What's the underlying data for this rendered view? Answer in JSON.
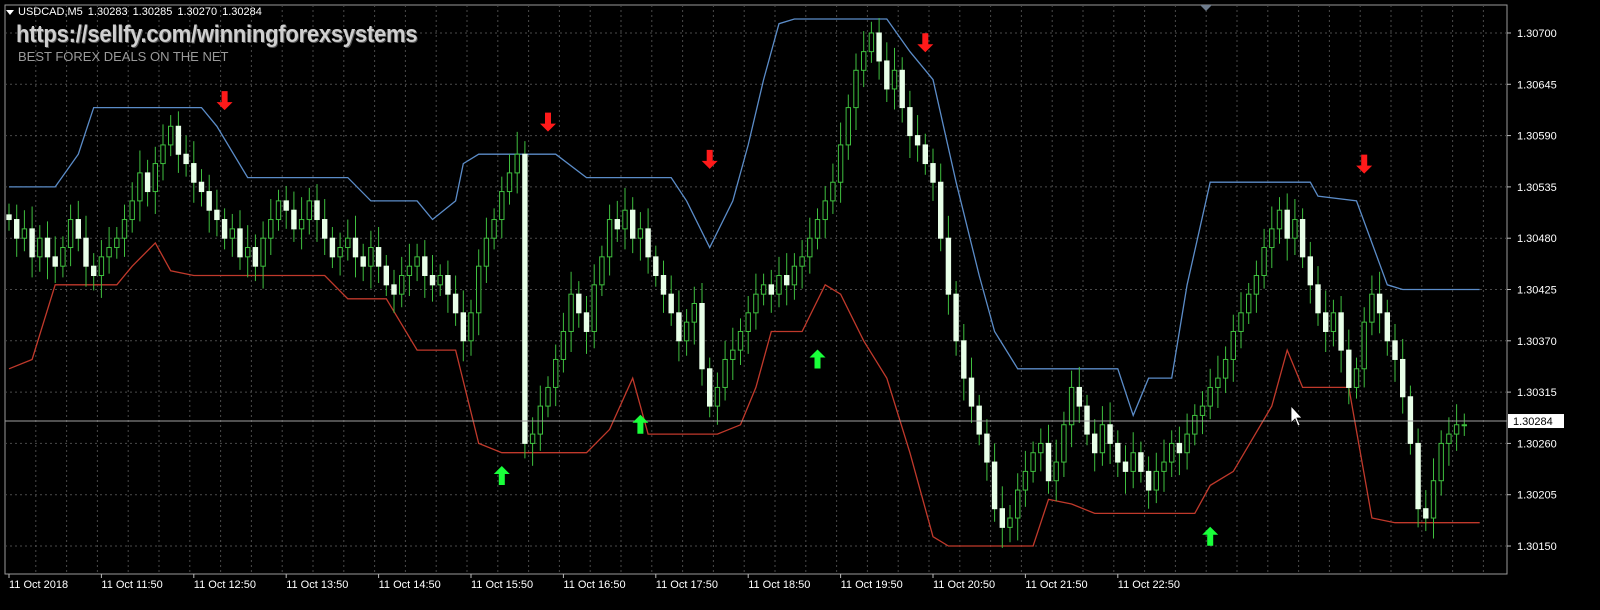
{
  "window": {
    "symbol": "USDCAD,M5",
    "ohlc": [
      "1.30283",
      "1.30285",
      "1.30270",
      "1.30284"
    ]
  },
  "watermark": {
    "url": "https://sellfy.com/winningforexsystems",
    "tagline": "BEST FOREX DEALS ON THE NET"
  },
  "colors": {
    "background": "#000000",
    "grid": "#4a4a4a",
    "bull_candle": "#3fbf3f",
    "bear_candle": "#e8ffe8",
    "upper_channel": "#5b8cc8",
    "lower_channel": "#c0392b",
    "sell_arrow": "#ff1a1a",
    "buy_arrow": "#19ff3a",
    "axis_text": "#ffffff",
    "price_line": "#a0a0a0"
  },
  "chart_data": {
    "type": "candlestick",
    "x_tick_labels": [
      "11 Oct 2018",
      "11 Oct 11:50",
      "11 Oct 12:50",
      "11 Oct 13:50",
      "11 Oct 14:50",
      "11 Oct 15:50",
      "11 Oct 16:50",
      "11 Oct 17:50",
      "11 Oct 18:50",
      "11 Oct 19:50",
      "11 Oct 20:50",
      "11 Oct 21:50",
      "11 Oct 22:50"
    ],
    "y_tick_labels": [
      "1.30700",
      "1.30645",
      "1.30590",
      "1.30535",
      "1.30480",
      "1.30425",
      "1.30370",
      "1.30315",
      "1.30260",
      "1.30205",
      "1.30150"
    ],
    "ylim": [
      1.3012,
      1.3073
    ],
    "bars_per_hour": 12,
    "current_price": 1.30284,
    "current_price_label": "1.30284",
    "close": [
      1.305,
      1.3048,
      1.3049,
      1.3046,
      1.3048,
      1.3046,
      1.3045,
      1.3047,
      1.305,
      1.3048,
      1.3045,
      1.3044,
      1.3046,
      1.3047,
      1.3048,
      1.305,
      1.3052,
      1.3055,
      1.3053,
      1.3056,
      1.3058,
      1.306,
      1.3057,
      1.3056,
      1.3054,
      1.3053,
      1.3051,
      1.305,
      1.3048,
      1.3049,
      1.3046,
      1.3047,
      1.3045,
      1.3048,
      1.305,
      1.3052,
      1.3051,
      1.3049,
      1.305,
      1.3052,
      1.305,
      1.3048,
      1.3046,
      1.3047,
      1.3048,
      1.3046,
      1.3045,
      1.3047,
      1.3045,
      1.3043,
      1.3042,
      1.3044,
      1.3045,
      1.3046,
      1.3044,
      1.3043,
      1.3044,
      1.3042,
      1.304,
      1.3037,
      1.304,
      1.3045,
      1.3048,
      1.305,
      1.3053,
      1.3055,
      1.3057,
      1.3026,
      1.3027,
      1.303,
      1.3032,
      1.3035,
      1.3038,
      1.3042,
      1.304,
      1.3038,
      1.3043,
      1.3046,
      1.305,
      1.3049,
      1.3051,
      1.3048,
      1.3049,
      1.3046,
      1.3044,
      1.3042,
      1.304,
      1.3037,
      1.3039,
      1.3041,
      1.3034,
      1.303,
      1.3032,
      1.3035,
      1.3036,
      1.3038,
      1.304,
      1.3042,
      1.3043,
      1.3042,
      1.3044,
      1.3043,
      1.3045,
      1.3046,
      1.3048,
      1.305,
      1.3052,
      1.3054,
      1.3058,
      1.3062,
      1.3066,
      1.3068,
      1.307,
      1.3067,
      1.3064,
      1.3066,
      1.3062,
      1.3059,
      1.3058,
      1.3056,
      1.3054,
      1.3048,
      1.3042,
      1.3037,
      1.3033,
      1.303,
      1.3027,
      1.3024,
      1.3019,
      1.3017,
      1.3018,
      1.3021,
      1.3023,
      1.3025,
      1.3026,
      1.3022,
      1.3024,
      1.3028,
      1.3032,
      1.303,
      1.3027,
      1.3025,
      1.3028,
      1.3026,
      1.3024,
      1.3023,
      1.3025,
      1.3023,
      1.3021,
      1.3023,
      1.3024,
      1.3026,
      1.3025,
      1.3027,
      1.3029,
      1.303,
      1.3032,
      1.3033,
      1.3035,
      1.3038,
      1.304,
      1.3042,
      1.3044,
      1.3047,
      1.3049,
      1.3051,
      1.3048,
      1.305,
      1.3046,
      1.3043,
      1.304,
      1.3038,
      1.304,
      1.3036,
      1.3032,
      1.3034,
      1.3039,
      1.3042,
      1.304,
      1.3037,
      1.3035,
      1.3031,
      1.3026,
      1.3019,
      1.3018,
      1.3022,
      1.3026,
      1.3027,
      1.3028,
      1.3028
    ],
    "upper_channel": [
      [
        0,
        1.30535
      ],
      [
        6,
        1.30535
      ],
      [
        9,
        1.3057
      ],
      [
        11,
        1.3062
      ],
      [
        25,
        1.3062
      ],
      [
        27,
        1.306
      ],
      [
        31,
        1.30545
      ],
      [
        44,
        1.30545
      ],
      [
        47,
        1.3052
      ],
      [
        53,
        1.3052
      ],
      [
        55,
        1.305
      ],
      [
        58,
        1.3052
      ],
      [
        59,
        1.3056
      ],
      [
        61,
        1.3057
      ],
      [
        71,
        1.3057
      ],
      [
        75,
        1.30545
      ],
      [
        86,
        1.30545
      ],
      [
        88,
        1.3052
      ],
      [
        91,
        1.3047
      ],
      [
        94,
        1.3052
      ],
      [
        96,
        1.3058
      ],
      [
        98,
        1.3065
      ],
      [
        100,
        1.3071
      ],
      [
        102,
        1.30715
      ],
      [
        114,
        1.30715
      ],
      [
        117,
        1.3068
      ],
      [
        120,
        1.3065
      ],
      [
        123,
        1.3054
      ],
      [
        126,
        1.3044
      ],
      [
        128,
        1.3038
      ],
      [
        131,
        1.3034
      ],
      [
        144,
        1.3034
      ],
      [
        146,
        1.3029
      ],
      [
        148,
        1.3033
      ],
      [
        151,
        1.3033
      ],
      [
        153,
        1.3043
      ],
      [
        156,
        1.3054
      ],
      [
        169,
        1.3054
      ],
      [
        170,
        1.30525
      ],
      [
        175,
        1.3052
      ],
      [
        179,
        1.3043
      ],
      [
        181,
        1.30425
      ],
      [
        191,
        1.30425
      ]
    ],
    "lower_channel": [
      [
        0,
        1.3034
      ],
      [
        3,
        1.3035
      ],
      [
        6,
        1.3043
      ],
      [
        10,
        1.3043
      ],
      [
        14,
        1.3043
      ],
      [
        16,
        1.3045
      ],
      [
        19,
        1.30475
      ],
      [
        21,
        1.30445
      ],
      [
        24,
        1.3044
      ],
      [
        28,
        1.3044
      ],
      [
        33,
        1.3044
      ],
      [
        41,
        1.3044
      ],
      [
        44,
        1.30415
      ],
      [
        49,
        1.30415
      ],
      [
        53,
        1.3036
      ],
      [
        58,
        1.3036
      ],
      [
        61,
        1.3026
      ],
      [
        64,
        1.3025
      ],
      [
        75,
        1.3025
      ],
      [
        78,
        1.30275
      ],
      [
        81,
        1.3033
      ],
      [
        83,
        1.3027
      ],
      [
        92,
        1.3027
      ],
      [
        95,
        1.3028
      ],
      [
        97,
        1.3032
      ],
      [
        99,
        1.3038
      ],
      [
        103,
        1.3038
      ],
      [
        106,
        1.3043
      ],
      [
        108,
        1.3042
      ],
      [
        111,
        1.3037
      ],
      [
        114,
        1.3033
      ],
      [
        117,
        1.3025
      ],
      [
        120,
        1.3016
      ],
      [
        122,
        1.3015
      ],
      [
        133,
        1.3015
      ],
      [
        135,
        1.302
      ],
      [
        138,
        1.30195
      ],
      [
        141,
        1.30185
      ],
      [
        154,
        1.30185
      ],
      [
        156,
        1.30215
      ],
      [
        159,
        1.3023
      ],
      [
        164,
        1.303
      ],
      [
        166,
        1.3036
      ],
      [
        168,
        1.3032
      ],
      [
        174,
        1.3032
      ],
      [
        177,
        1.3018
      ],
      [
        180,
        1.30175
      ],
      [
        191,
        1.30175
      ]
    ],
    "sell_arrows": [
      [
        28,
        1.30628
      ],
      [
        70,
        1.30605
      ],
      [
        91,
        1.30565
      ],
      [
        119,
        1.3069
      ],
      [
        176,
        1.3056
      ]
    ],
    "buy_arrows": [
      [
        64,
        1.30225
      ],
      [
        82,
        1.3028
      ],
      [
        105,
        1.3035
      ],
      [
        156,
        1.3016
      ]
    ]
  }
}
